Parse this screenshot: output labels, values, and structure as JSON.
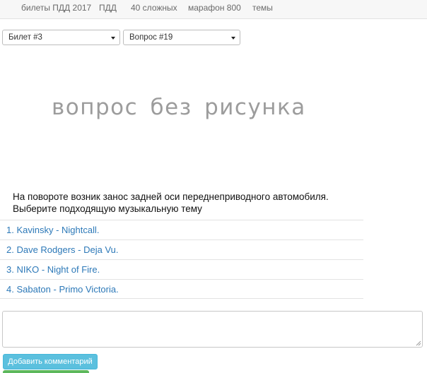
{
  "nav": {
    "items": [
      "билеты ПДД 2017",
      "ПДД",
      "40 сложных",
      "марафон 800",
      "темы"
    ]
  },
  "selectors": {
    "ticket": "Билет #3",
    "question": "Вопрос #19"
  },
  "image_placeholder": "вопрос без рисунка",
  "question": {
    "line1": "На повороте возник занос задней оси переднеприводного автомобиля.",
    "line2": "Выберите подходящую музыкальную тему"
  },
  "answers": [
    "1. Kavinsky - Nightcall.",
    "2. Dave Rodgers - Deja Vu.",
    "3. NIKO - Night of Fire.",
    "4. Sabaton - Primo Victoria."
  ],
  "comment": {
    "value": "",
    "button_label": "Добавить комментарий"
  },
  "colors": {
    "link": "#2d79b8",
    "info_button": "#5bc0de",
    "success_button": "#5cb85c"
  }
}
